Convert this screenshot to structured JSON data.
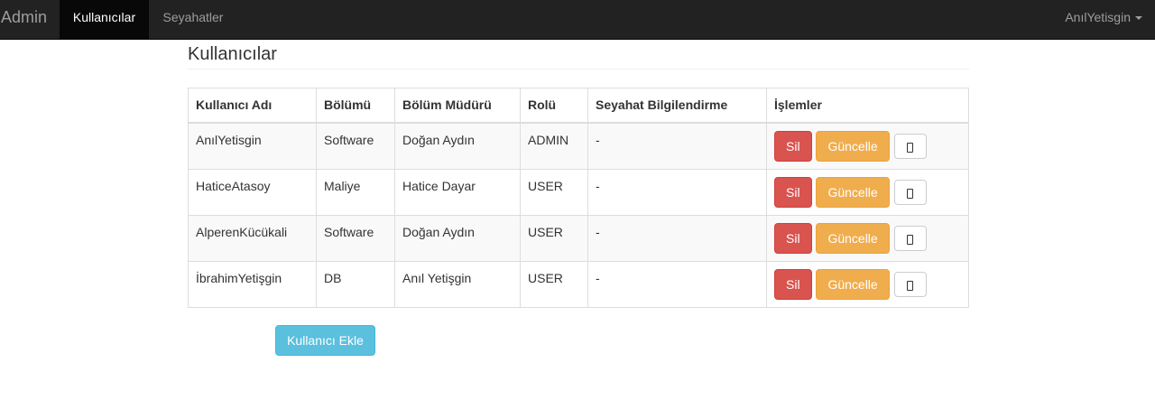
{
  "navbar": {
    "brand": "Admin",
    "tabs": [
      {
        "label": "Kullanıcılar",
        "active": true
      },
      {
        "label": "Seyahatler",
        "active": false
      }
    ],
    "user": "AnılYetisgin"
  },
  "page": {
    "title": "Kullanıcılar"
  },
  "table": {
    "headers": [
      "Kullanıcı Adı",
      "Bölümü",
      "Bölüm Müdürü",
      "Rolü",
      "Seyahat Bilgilendirme",
      "İşlemler"
    ],
    "rows": [
      {
        "username": "AnılYetisgin",
        "department": "Software",
        "manager": "Doğan Aydın",
        "role": "ADMIN",
        "travel": "-"
      },
      {
        "username": "HaticeAtasoy",
        "department": "Maliye",
        "manager": "Hatice Dayar",
        "role": "USER",
        "travel": "-"
      },
      {
        "username": "AlperenKücükali",
        "department": "Software",
        "manager": "Doğan Aydın",
        "role": "USER",
        "travel": "-"
      },
      {
        "username": "İbrahimYetişgin",
        "department": "DB",
        "manager": "Anıl Yetişgin",
        "role": "USER",
        "travel": "-"
      }
    ],
    "actions": {
      "delete_label": "Sil",
      "update_label": "Güncelle",
      "phone_icon": "mobile-phone-icon"
    }
  },
  "add_user_label": "Kullanıcı Ekle",
  "colors": {
    "navbar": "#222222",
    "danger": "#d9534f",
    "warning": "#f0ad4e",
    "info": "#5bc0de"
  }
}
